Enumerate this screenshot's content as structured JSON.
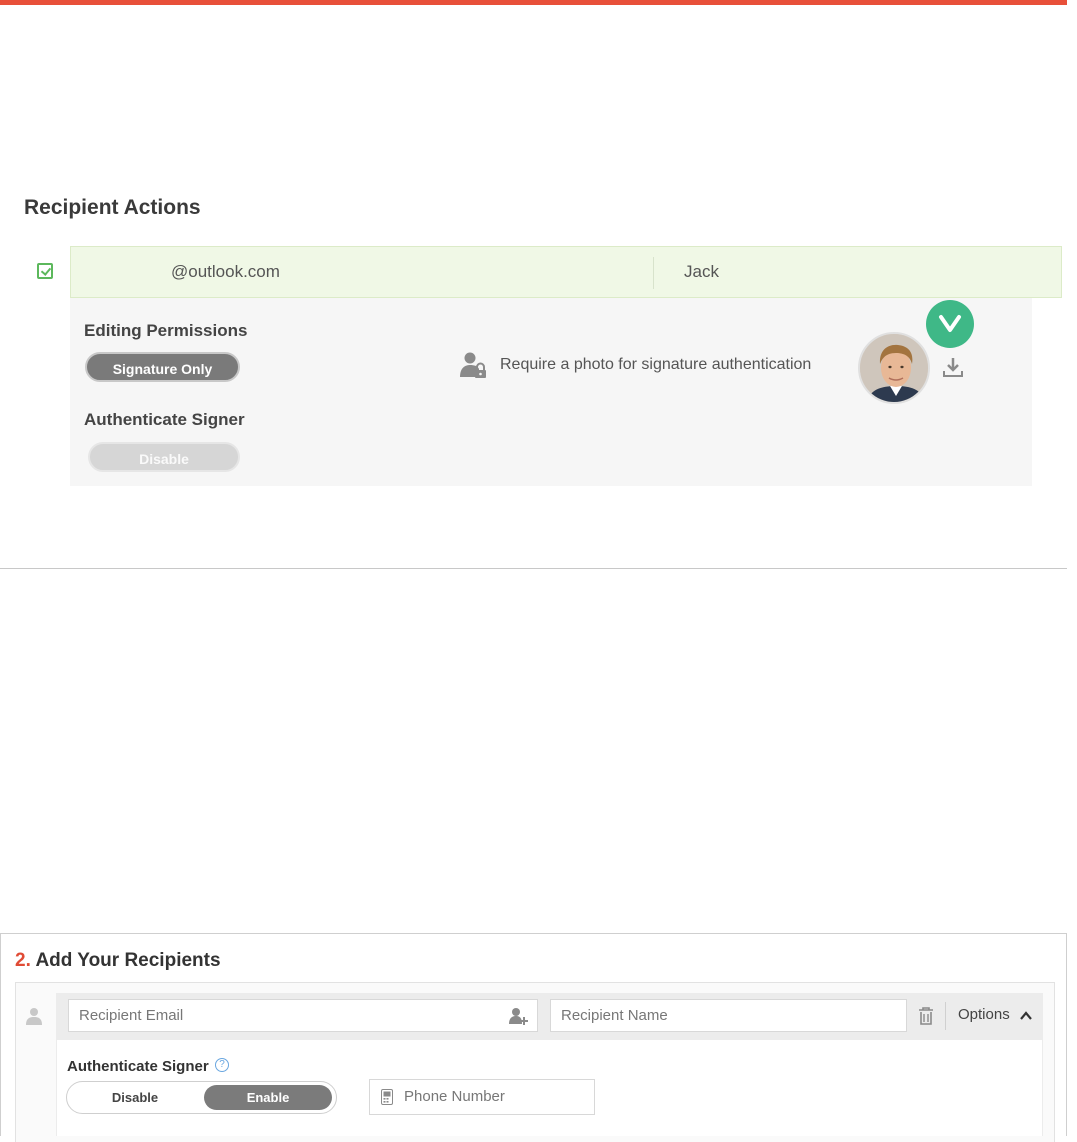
{
  "recipient_actions": {
    "title": "Recipient Actions",
    "recipient": {
      "email": "@outlook.com",
      "name": "Jack",
      "checked": true
    },
    "editing_permissions": {
      "label": "Editing Permissions",
      "value": "Signature Only"
    },
    "authenticate_signer": {
      "label": "Authenticate Signer",
      "value": "Disable"
    },
    "photo_requirement": {
      "text": "Require a photo for signature authentication",
      "icon": "user-lock-icon"
    },
    "badge_icon": "check-chevron-icon",
    "download_icon": "download-icon"
  },
  "add_recipients": {
    "step_number": "2.",
    "title": "Add Your Recipients",
    "email_placeholder": "Recipient Email",
    "name_placeholder": "Recipient Name",
    "options_label": "Options",
    "authenticate_signer": {
      "label": "Authenticate Signer",
      "disable_label": "Disable",
      "enable_label": "Enable",
      "selected": "Enable"
    },
    "phone_placeholder": "Phone Number"
  },
  "colors": {
    "accent_red": "#e8503a",
    "badge_green": "#3fb887",
    "row_green": "#f0f8e6",
    "checkbox_green": "#5cb85c",
    "pill_grey": "#7a7a7a"
  }
}
